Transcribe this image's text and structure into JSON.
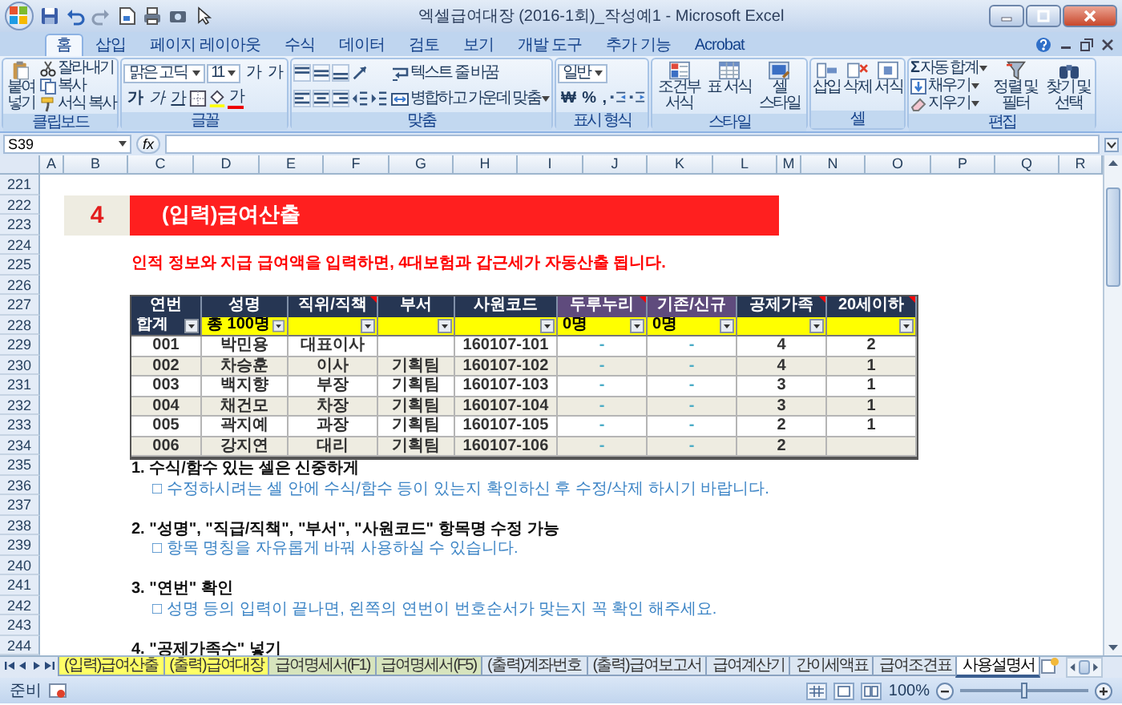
{
  "window": {
    "title": "엑셀급여대장 (2016-1회)_작성예1 - Microsoft Excel"
  },
  "ribbon_tabs": [
    {
      "label": "홈",
      "selected": true
    },
    {
      "label": "삽입",
      "selected": false
    },
    {
      "label": "페이지 레이아웃",
      "selected": false
    },
    {
      "label": "수식",
      "selected": false
    },
    {
      "label": "데이터",
      "selected": false
    },
    {
      "label": "검토",
      "selected": false
    },
    {
      "label": "보기",
      "selected": false
    },
    {
      "label": "개발 도구",
      "selected": false
    },
    {
      "label": "추가 기능",
      "selected": false
    },
    {
      "label": "Acrobat",
      "selected": false
    }
  ],
  "ribbon": {
    "clipboard": {
      "paste": "붙여넣기",
      "cut": "잘라내기",
      "copy": "복사",
      "format_painter": "서식 복사",
      "label": "클립보드"
    },
    "font": {
      "name": "맑은 고딕",
      "size": "11",
      "size_buttons": [
        "가",
        "가"
      ],
      "style_buttons": [
        "가",
        "가",
        "가"
      ],
      "font_color": "가",
      "label": "글꼴"
    },
    "alignment": {
      "wrap_text": "텍스트 줄 바꿈",
      "merge_center": "병합하고 가운데 맞춤",
      "label": "맞춤"
    },
    "number": {
      "format": "일반",
      "buttons": [
        "₩",
        "%",
        ","
      ],
      "label": "표시 형식"
    },
    "styles": {
      "buttons": [
        "조건부 서식",
        "표 서식",
        "셀 스타일"
      ],
      "label": "스타일"
    },
    "cells": {
      "buttons": [
        "삽입",
        "삭제",
        "서식"
      ],
      "label": "셀"
    },
    "editing": {
      "autosum_symbol": "Σ",
      "autosum": "자동 합계",
      "fill": "채우기",
      "clear": "지우기",
      "sort_filter": "정렬 및 필터",
      "find_select": "찾기 및 선택",
      "label": "편집"
    }
  },
  "formula_bar": {
    "name_box": "S39",
    "function_symbol": "fx"
  },
  "sheet": {
    "column_letters": [
      "A",
      "B",
      "C",
      "D",
      "E",
      "F",
      "G",
      "H",
      "I",
      "J",
      "K",
      "L",
      "M",
      "N",
      "O",
      "P",
      "Q",
      "R"
    ],
    "row_numbers": [
      "221",
      "222",
      "223",
      "224",
      "225",
      "226",
      "227",
      "228",
      "229",
      "230",
      "231",
      "232",
      "233",
      "234",
      "235",
      "236",
      "237",
      "238",
      "239",
      "240",
      "241",
      "242",
      "243",
      "244"
    ],
    "section": {
      "number": "4",
      "title": "(입력)급여산출"
    },
    "description": "인적 정보와 지급 급여액을 입력하면, 4대보험과 갑근세가 자동산출 됩니다.",
    "table": {
      "headers": [
        {
          "label": "연번",
          "color": "#263653",
          "comment": false
        },
        {
          "label": "성명",
          "color": "#263653",
          "comment": false
        },
        {
          "label": "직위/직책",
          "color": "#263653",
          "comment": true
        },
        {
          "label": "부서",
          "color": "#263653",
          "comment": false
        },
        {
          "label": "사원코드",
          "color": "#263653",
          "comment": false
        },
        {
          "label": "두루누리",
          "color": "#5f4b7d",
          "comment": true
        },
        {
          "label": "기존/신규",
          "color": "#5f4b7d",
          "comment": false
        },
        {
          "label": "공제가족",
          "color": "#263653",
          "comment": true
        },
        {
          "label": "20세이하",
          "color": "#263653",
          "comment": true
        }
      ],
      "filter_row": [
        {
          "text": "합계",
          "color": "#263653"
        },
        {
          "text": "총 100명",
          "color": "#ffff00"
        },
        {
          "color": "#ffff00"
        },
        {
          "color": "#ffff00"
        },
        {
          "color": "#ffff00"
        },
        {
          "text": "0명",
          "color": "#ffff00"
        },
        {
          "text": "0명",
          "color": "#ffff00"
        },
        {
          "color": "#ffff00"
        },
        {
          "color": "#ffff00"
        }
      ],
      "rows": [
        [
          "001",
          "박민용",
          "대표이사",
          null,
          "160107-101",
          "-",
          "-",
          "4",
          "2"
        ],
        [
          "002",
          "차승훈",
          "이사",
          "기획팀",
          "160107-102",
          "-",
          "-",
          "4",
          "1"
        ],
        [
          "003",
          "백지향",
          "부장",
          "기획팀",
          "160107-103",
          "-",
          "-",
          "3",
          "1"
        ],
        [
          "004",
          "채건모",
          "차장",
          "기획팀",
          "160107-104",
          "-",
          "-",
          "3",
          "1"
        ],
        [
          "005",
          "곽지예",
          "과장",
          "기획팀",
          "160107-105",
          "-",
          "-",
          "2",
          "1"
        ],
        [
          "006",
          "강지연",
          "대리",
          "기획팀",
          "160107-106",
          "-",
          "-",
          "2",
          null
        ]
      ]
    },
    "notes": [
      {
        "heading": "1. 수식/함수 있는 셀은 신중하게",
        "detail": "□ 수정하시려는 셀 안에 수식/함수 등이 있는지 확인하신 후 수정/삭제 하시기 바랍니다."
      },
      {
        "heading": "2. \"성명\", \"직급/직책\", \"부서\", \"사원코드\" 항목명 수정 가능",
        "detail": "□ 항목 명칭을 자유롭게 바꿔 사용하실 수 있습니다."
      },
      {
        "heading": "3. \"연번\" 확인",
        "detail": "□ 성명 등의 입력이 끝나면, 왼쪽의 연번이 번호순서가 맞는지 꼭 확인 해주세요."
      },
      {
        "heading": "4. \"공제가족수\" 넣기"
      }
    ]
  },
  "sheet_tabs": [
    {
      "label": "(입력)급여산출",
      "color": "#ffff66",
      "selected": false
    },
    {
      "label": "(출력)급여대장",
      "color": "#ffff66",
      "selected": false
    },
    {
      "label": "급여명세서(F1)",
      "color": "#d7e4bd",
      "selected": false
    },
    {
      "label": "급여명세서(F5)",
      "color": "#d7e4bd",
      "selected": false
    },
    {
      "label": "(출력)계좌번호",
      "color": "#dce6f2",
      "selected": false
    },
    {
      "label": "(출력)급여보고서",
      "color": "#dce6f2",
      "selected": false
    },
    {
      "label": "급여계산기",
      "color": "#dce6f2",
      "selected": false
    },
    {
      "label": "간이세액표",
      "color": "#dce6f2",
      "selected": false
    },
    {
      "label": "급여조견표",
      "color": "#dce6f2",
      "selected": false
    },
    {
      "label": "사용설명서",
      "color": "#ffffff",
      "selected": true
    }
  ],
  "status_bar": {
    "status": "준비",
    "zoom": "100%",
    "zoom_slider": {
      "level": 0.5
    }
  }
}
